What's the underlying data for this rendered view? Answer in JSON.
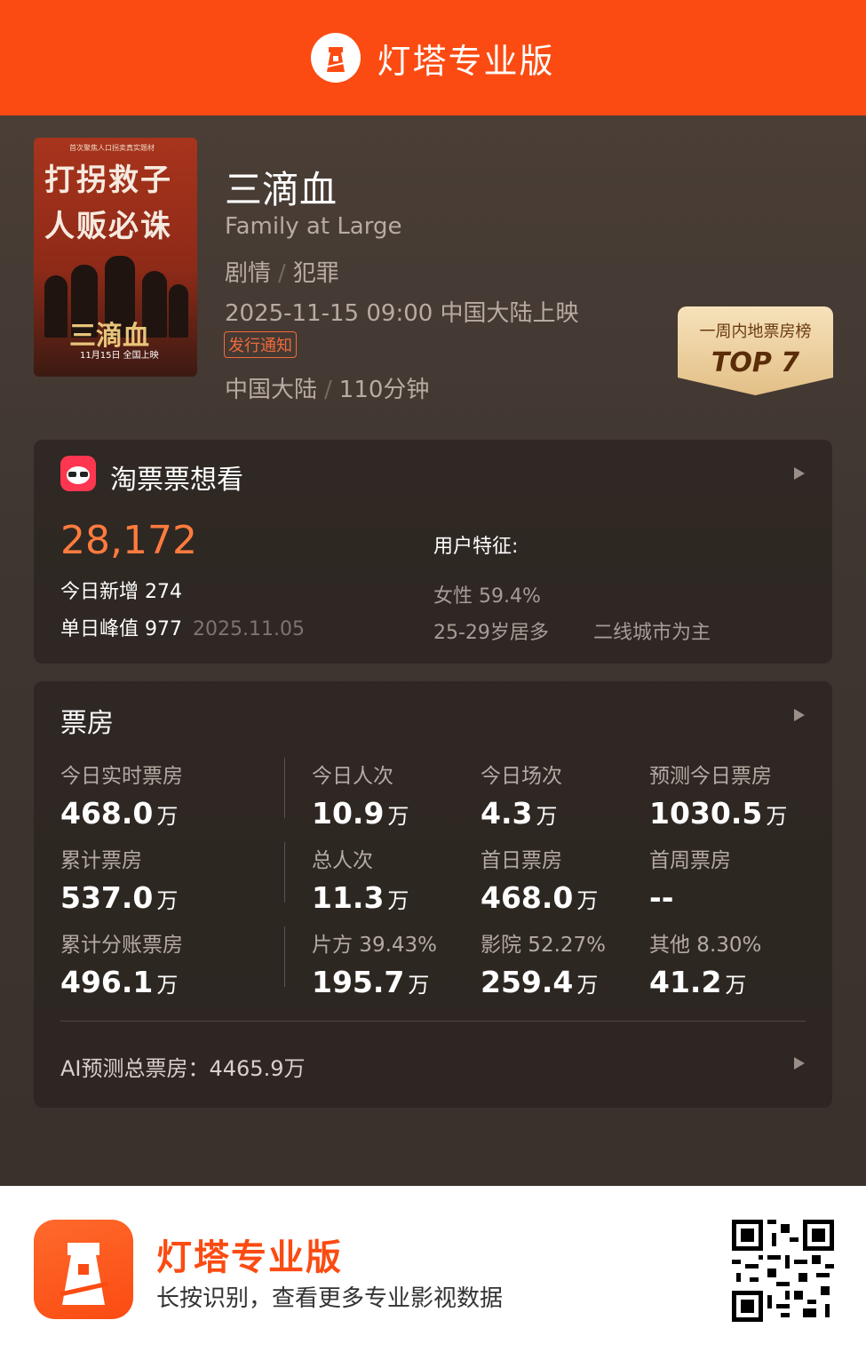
{
  "header": {
    "app_name": "灯塔专业版",
    "brand_color": "#fb4b12"
  },
  "movie": {
    "title": "三滴血",
    "english_title": "Family at Large",
    "genres": [
      "剧情",
      "犯罪"
    ],
    "release": "2025-11-15 09:00 中国大陆上映",
    "release_tag": "发行通知",
    "region": "中国大陆",
    "duration": "110分钟",
    "poster": {
      "top_tagline": "首次聚焦人口拐卖真实题材",
      "line1": "打拐救子",
      "line2": "人贩必诛",
      "title": "三滴血",
      "date": "11月15日 全国上映"
    },
    "badge": {
      "line1": "一周内地票房榜",
      "line2": "TOP 7"
    }
  },
  "taopiao": {
    "title": "淘票票想看",
    "want_count": "28,172",
    "today_new": "今日新增 274",
    "peak": "单日峰值 977",
    "peak_date": "2025.11.05",
    "user_label": "用户特征:",
    "gender": "女性 59.4%",
    "age": "25-29岁居多",
    "city": "二线城市为主"
  },
  "box_office": {
    "title": "票房",
    "unit": "万",
    "rows": [
      [
        {
          "label": "今日实时票房",
          "value": "468.0"
        },
        {
          "label": "今日人次",
          "value": "10.9"
        },
        {
          "label": "今日场次",
          "value": "4.3"
        },
        {
          "label": "预测今日票房",
          "value": "1030.5"
        }
      ],
      [
        {
          "label": "累计票房",
          "value": "537.0"
        },
        {
          "label": "总人次",
          "value": "11.3"
        },
        {
          "label": "首日票房",
          "value": "468.0"
        },
        {
          "label": "首周票房",
          "value": "--"
        }
      ],
      [
        {
          "label": "累计分账票房",
          "value": "496.1"
        },
        {
          "label": "片方 39.43%",
          "value": "195.7"
        },
        {
          "label": "影院 52.27%",
          "value": "259.4"
        },
        {
          "label": "其他 8.30%",
          "value": "41.2"
        }
      ]
    ],
    "ai_forecast": "AI预测总票房：4465.9万"
  },
  "footer": {
    "app_name": "灯塔专业版",
    "description": "长按识别，查看更多专业影视数据"
  }
}
